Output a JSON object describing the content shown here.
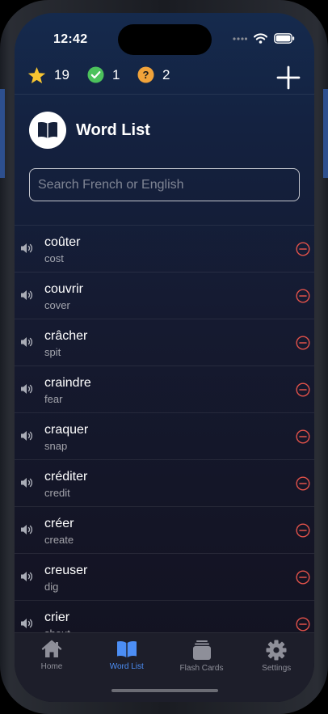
{
  "status": {
    "time": "12:42"
  },
  "stats": {
    "stars": "19",
    "known": "1",
    "unknown": "2"
  },
  "header": {
    "title": "Word List"
  },
  "search": {
    "placeholder": "Search French or English"
  },
  "words": [
    {
      "french": "coûter",
      "english": "cost"
    },
    {
      "french": "couvrir",
      "english": "cover"
    },
    {
      "french": "crâcher",
      "english": "spit"
    },
    {
      "french": "craindre",
      "english": "fear"
    },
    {
      "french": "craquer",
      "english": "snap"
    },
    {
      "french": "créditer",
      "english": "credit"
    },
    {
      "french": "créer",
      "english": "create"
    },
    {
      "french": "creuser",
      "english": "dig"
    },
    {
      "french": "crier",
      "english": "shout"
    }
  ],
  "tabs": [
    {
      "label": "Home",
      "icon": "house-icon"
    },
    {
      "label": "Word List",
      "icon": "book-icon",
      "active": true
    },
    {
      "label": "Flash Cards",
      "icon": "cards-icon"
    },
    {
      "label": "Settings",
      "icon": "gear-icon"
    }
  ],
  "colors": {
    "accent": "#4c8ef5",
    "star": "#f7c531",
    "known": "#4cc25c",
    "unknown": "#f1a33a",
    "remove": "#e2524a"
  }
}
